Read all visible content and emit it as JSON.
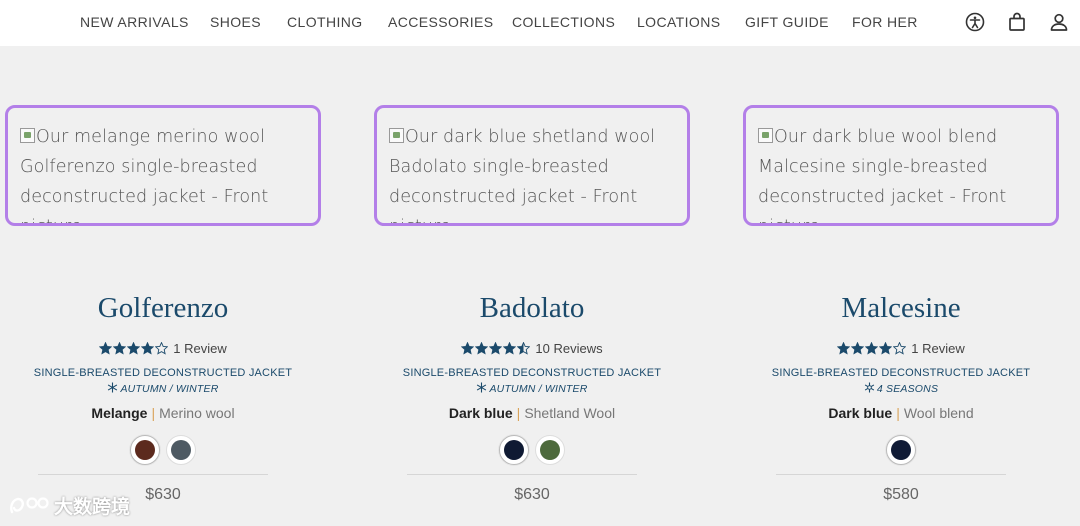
{
  "nav": {
    "items": [
      {
        "label": "NEW ARRIVALS"
      },
      {
        "label": "SHOES"
      },
      {
        "label": "CLOTHING"
      },
      {
        "label": "ACCESSORIES"
      },
      {
        "label": "COLLECTIONS"
      },
      {
        "label": "LOCATIONS"
      },
      {
        "label": "GIFT GUIDE"
      },
      {
        "label": "FOR HER"
      }
    ],
    "icons": [
      "accessibility-icon",
      "shopping-bag-icon",
      "account-icon"
    ]
  },
  "products": [
    {
      "image_alt": "Our melange merino wool Golferenzo single-breasted deconstructed jacket - Front picture",
      "name": "Golferenzo",
      "rating": 4,
      "review_label": "1 Review",
      "type": "SINGLE-BREASTED DECONSTRUCTED JACKET",
      "season": "AUTUMN / WINTER",
      "color": "Melange",
      "fabric": "Merino wool",
      "swatches": [
        "#5c2a1e",
        "#4e5a63"
      ],
      "price": "$630"
    },
    {
      "image_alt": "Our dark blue shetland wool Badolato single-breasted deconstructed jacket - Front picture",
      "name": "Badolato",
      "rating": 4.5,
      "review_label": "10 Reviews",
      "type": "SINGLE-BREASTED DECONSTRUCTED JACKET",
      "season": "AUTUMN / WINTER",
      "color": "Dark blue",
      "fabric": "Shetland Wool",
      "swatches": [
        "#0f1a33",
        "#4d6a3c"
      ],
      "price": "$630"
    },
    {
      "image_alt": "Our dark blue wool blend Malcesine single-breasted deconstructed jacket - Front picture",
      "name": "Malcesine",
      "rating": 4,
      "review_label": "1 Review",
      "type": "SINGLE-BREASTED DECONSTRUCTED JACKET",
      "season": "4 SEASONS",
      "color": "Dark blue",
      "fabric": "Wool blend",
      "swatches": [
        "#101b36"
      ],
      "price": "$580"
    }
  ],
  "watermark": {
    "text": "大数跨境"
  },
  "colors": {
    "accent_outline": "#b37fe8",
    "brand_blue": "#1b4a6b",
    "divider_orange": "#d9a35a"
  }
}
